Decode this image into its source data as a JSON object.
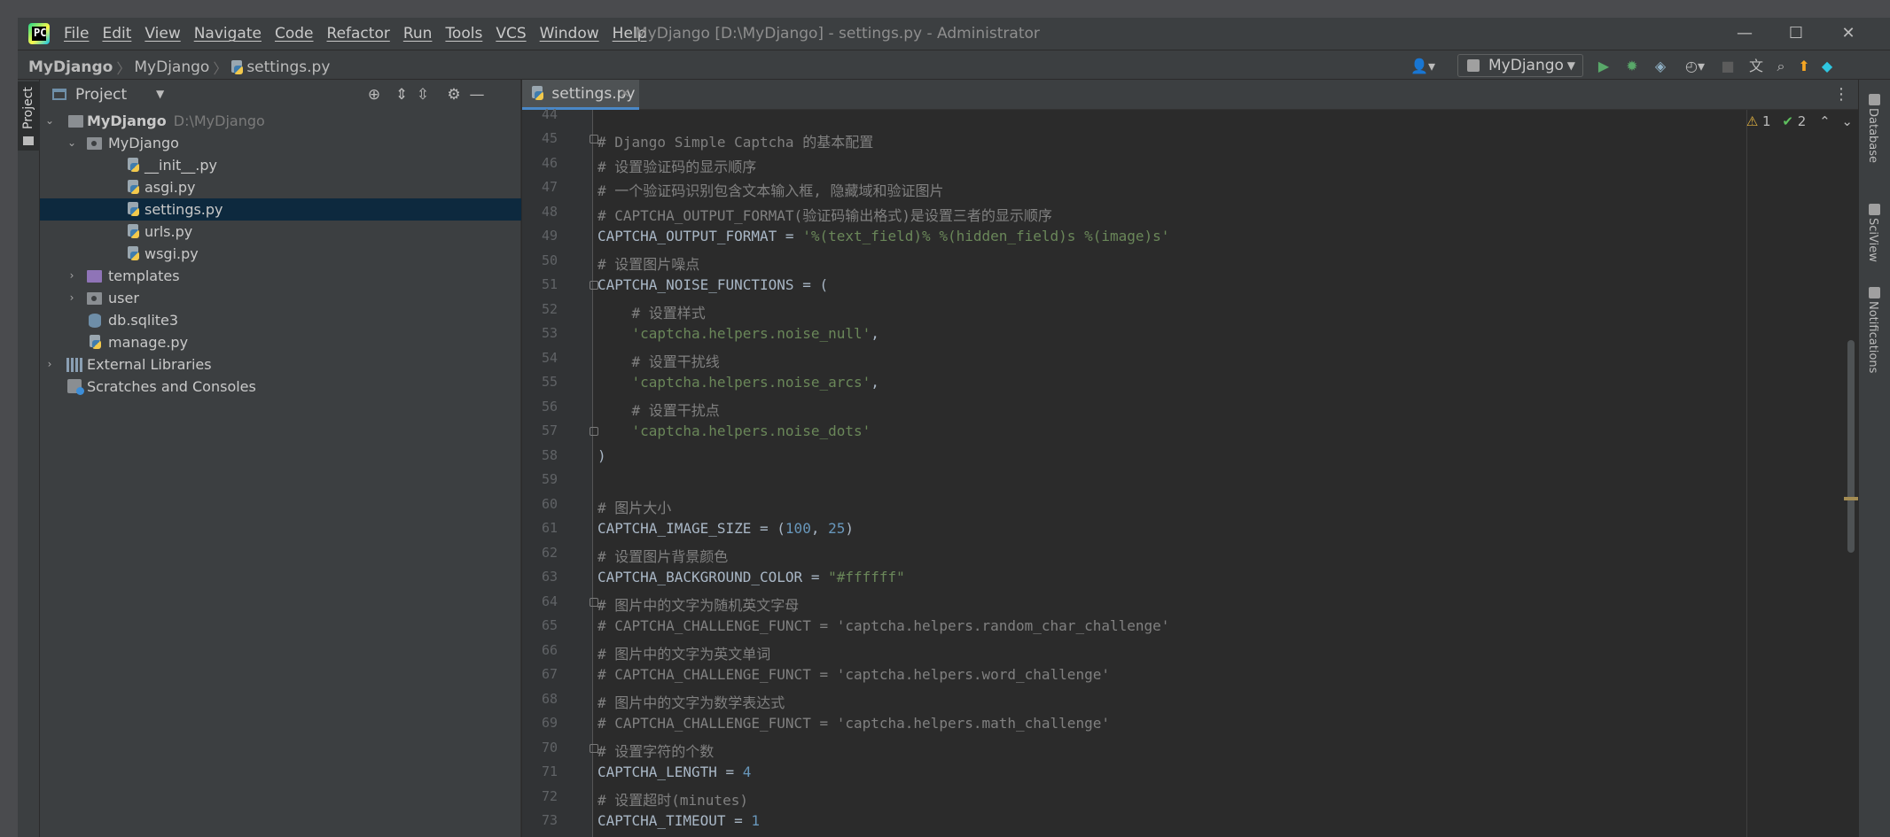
{
  "titlebar": {
    "menu": [
      "File",
      "Edit",
      "View",
      "Navigate",
      "Code",
      "Refactor",
      "Run",
      "Tools",
      "VCS",
      "Window",
      "Help"
    ],
    "window_title": "MyDjango [D:\\MyDjango] - settings.py - Administrator",
    "controls": {
      "minimize": "—",
      "maximize": "☐",
      "close": "✕"
    }
  },
  "navbar": {
    "crumbs": [
      "MyDjango",
      "MyDjango",
      "settings.py"
    ],
    "run_config": "MyDjango",
    "icons": [
      "user-icon",
      "run-icon",
      "debug-icon",
      "coverage-icon",
      "profile-icon",
      "stop-icon",
      "translate-icon",
      "search-icon",
      "update-icon",
      "jetbrains-icon"
    ]
  },
  "left_strip": {
    "project_tab": "Project"
  },
  "project": {
    "title": "Project",
    "tree": [
      {
        "label": "MyDjango",
        "path": "D:\\MyDjango",
        "kind": "root"
      },
      {
        "label": "MyDjango",
        "kind": "package"
      },
      {
        "label": "__init__.py",
        "kind": "py"
      },
      {
        "label": "asgi.py",
        "kind": "py"
      },
      {
        "label": "settings.py",
        "kind": "py"
      },
      {
        "label": "urls.py",
        "kind": "py"
      },
      {
        "label": "wsgi.py",
        "kind": "py"
      },
      {
        "label": "templates",
        "kind": "folder"
      },
      {
        "label": "user",
        "kind": "package"
      },
      {
        "label": "db.sqlite3",
        "kind": "db"
      },
      {
        "label": "manage.py",
        "kind": "py"
      },
      {
        "label": "External Libraries",
        "kind": "lib"
      },
      {
        "label": "Scratches and Consoles",
        "kind": "scratch"
      }
    ]
  },
  "editor": {
    "tab": "settings.py",
    "top_partial_line": "44",
    "inspections": {
      "warnings": "1",
      "weak_warnings": "2"
    },
    "lines": [
      {
        "n": "45",
        "t": "# Django Simple Captcha 的基本配置"
      },
      {
        "n": "46",
        "t": "# 设置验证码的显示顺序"
      },
      {
        "n": "47",
        "t": "# 一个验证码识别包含文本输入框, 隐藏域和验证图片"
      },
      {
        "n": "48",
        "t": "# CAPTCHA_OUTPUT_FORMAT(验证码输出格式)是设置三者的显示顺序"
      },
      {
        "n": "49",
        "t": "CAPTCHA_OUTPUT_FORMAT = '%(text_field)% %(hidden_field)s %(image)s'"
      },
      {
        "n": "50",
        "t": "# 设置图片噪点"
      },
      {
        "n": "51",
        "t": "CAPTCHA_NOISE_FUNCTIONS = ("
      },
      {
        "n": "52",
        "t": "    # 设置样式"
      },
      {
        "n": "53",
        "t": "    'captcha.helpers.noise_null',"
      },
      {
        "n": "54",
        "t": "    # 设置干扰线"
      },
      {
        "n": "55",
        "t": "    'captcha.helpers.noise_arcs',"
      },
      {
        "n": "56",
        "t": "    # 设置干扰点"
      },
      {
        "n": "57",
        "t": "    'captcha.helpers.noise_dots'"
      },
      {
        "n": "58",
        "t": ")"
      },
      {
        "n": "59",
        "t": ""
      },
      {
        "n": "60",
        "t": "# 图片大小"
      },
      {
        "n": "61",
        "t": "CAPTCHA_IMAGE_SIZE = (100, 25)"
      },
      {
        "n": "62",
        "t": "# 设置图片背景颜色"
      },
      {
        "n": "63",
        "t": "CAPTCHA_BACKGROUND_COLOR = \"#ffffff\""
      },
      {
        "n": "64",
        "t": "# 图片中的文字为随机英文字母"
      },
      {
        "n": "65",
        "t": "# CAPTCHA_CHALLENGE_FUNCT = 'captcha.helpers.random_char_challenge'"
      },
      {
        "n": "66",
        "t": "# 图片中的文字为英文单词"
      },
      {
        "n": "67",
        "t": "# CAPTCHA_CHALLENGE_FUNCT = 'captcha.helpers.word_challenge'"
      },
      {
        "n": "68",
        "t": "# 图片中的文字为数学表达式"
      },
      {
        "n": "69",
        "t": "# CAPTCHA_CHALLENGE_FUNCT = 'captcha.helpers.math_challenge'"
      },
      {
        "n": "70",
        "t": "# 设置字符的个数"
      },
      {
        "n": "71",
        "t": "CAPTCHA_LENGTH = 4"
      },
      {
        "n": "72",
        "t": "# 设置超时(minutes)"
      },
      {
        "n": "73",
        "t": "CAPTCHA_TIMEOUT = 1"
      }
    ]
  },
  "right_strip": {
    "tabs": [
      "Database",
      "SciView",
      "Notifications"
    ]
  },
  "colors": {
    "comment": "#808080",
    "string": "#6a8759",
    "number": "#6897bb",
    "text": "#a9b7c6",
    "selection": "#0d293e",
    "accent": "#4a88c7"
  }
}
